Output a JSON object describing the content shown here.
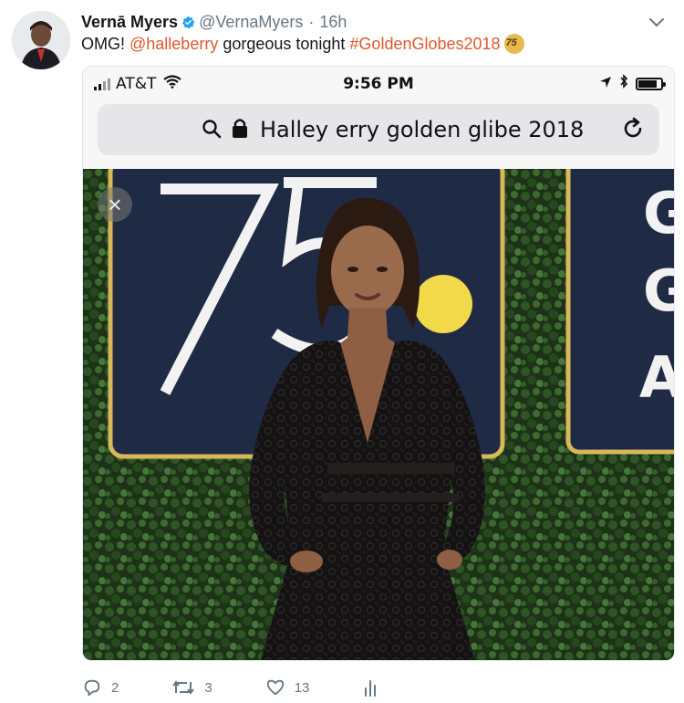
{
  "user": {
    "name": "Vernā Myers",
    "handle": "@VernaMyers",
    "time": "16h"
  },
  "tweet": {
    "prefix": "OMG!",
    "mention": "@halleberry",
    "middle": "gorgeous tonight",
    "hashtag": "#GoldenGlobes2018",
    "hashflag_text": "75"
  },
  "phone": {
    "carrier": "AT&T",
    "clock": "9:56 PM",
    "url": "Halley  erry golden glibe 2018"
  },
  "photo": {
    "sign_number": "75",
    "sign_letters": [
      "G",
      "G",
      "A"
    ]
  },
  "actions": {
    "replies": "2",
    "retweets": "3",
    "likes": "13"
  },
  "colors": {
    "link": "#e0582d",
    "muted": "#657786",
    "verified": "#1da1f2",
    "sign_gold": "#d9b85a",
    "sign_navy": "#1f2a44"
  }
}
